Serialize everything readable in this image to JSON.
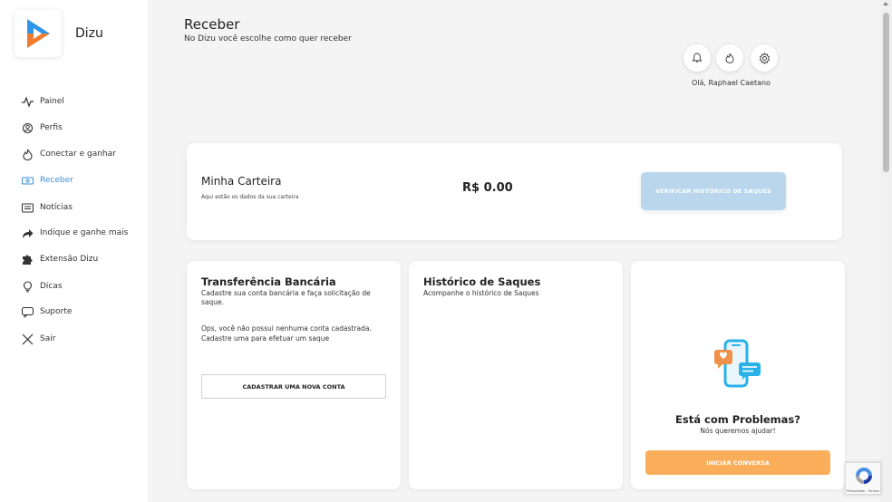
{
  "sidebar": {
    "brand": "Dizu",
    "items": [
      {
        "label": "Painel",
        "icon": "activity-icon"
      },
      {
        "label": "Perfis",
        "icon": "profiles-icon"
      },
      {
        "label": "Conectar e ganhar",
        "icon": "flame-icon"
      },
      {
        "label": "Receber",
        "icon": "money-icon",
        "active": true
      },
      {
        "label": "Notícias",
        "icon": "news-icon"
      },
      {
        "label": "Indique e ganhe mais",
        "icon": "share-arrow-icon"
      },
      {
        "label": "Extensão Dizu",
        "icon": "puzzle-icon"
      },
      {
        "label": "Dicas",
        "icon": "lightbulb-icon"
      },
      {
        "label": "Suporte",
        "icon": "chat-icon"
      },
      {
        "label": "Sair",
        "icon": "close-icon"
      }
    ]
  },
  "header": {
    "title": "Receber",
    "subtitle": "No Dizu você escolhe como quer receber",
    "greeting": "Olá, Raphael Caetano"
  },
  "wallet": {
    "title": "Minha Carteira",
    "subtitle": "Aqui estão os dados da sua carteira",
    "amount": "R$ 0.00",
    "button": "VERIFICAR HISTÓRICO DE SAQUES"
  },
  "bank": {
    "title": "Transferência Bancária",
    "subtitle": "Cadastre sua conta bancária e faça solicitação de saque.",
    "message": "Ops, você não possui nenhuma conta cadastrada. Cadastre uma para efetuar um saque",
    "button": "CADASTRAR UMA NOVA CONTA"
  },
  "history": {
    "title": "Histórico de Saques",
    "subtitle": "Acompanhe o histórico de Saques"
  },
  "support": {
    "title": "Está com Problemas?",
    "subtitle": "Nós queremos ajudar!",
    "button": "INICIAR CONVERSA"
  },
  "recaptcha": {
    "text": "Privacidade - Termos"
  },
  "colors": {
    "accent": "#3a8fd9",
    "wallet_button": "#b9d6ec",
    "orange_button": "#fbae5a"
  }
}
